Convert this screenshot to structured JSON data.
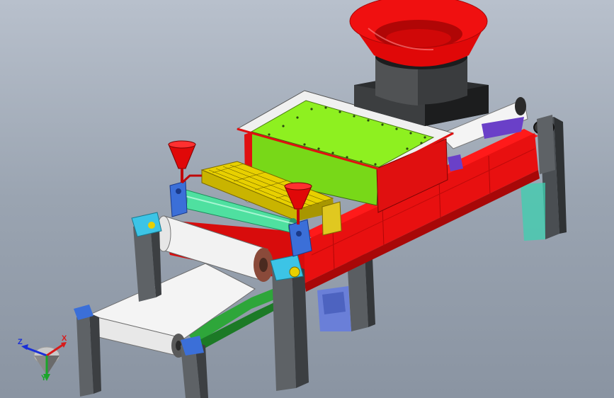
{
  "scene": {
    "background_top": "#b8c0cc",
    "background_bottom": "#8a94a2"
  },
  "colors": {
    "frame_red": "#e81010",
    "frame_red_dark": "#a80808",
    "leg_grey": "#5e6266",
    "leg_grey_dark": "#3c3f42",
    "belt_white": "#f2f2f2",
    "belt_green": "#3ab844",
    "roller_green": "#4fe0a0",
    "panel_lime": "#8ef020",
    "hopper_red": "#e00808",
    "hopper_dark": "#2c2e30",
    "bearing_blue": "#3b6fd8",
    "foot_cyan": "#3cc4e6",
    "mesh_yellow": "#e8d000",
    "purple_bar": "#6a40c8"
  },
  "triad": {
    "icon": "coordinate-triad-icon",
    "z_label": "Z",
    "x_label": "X",
    "y_label": "Y"
  }
}
